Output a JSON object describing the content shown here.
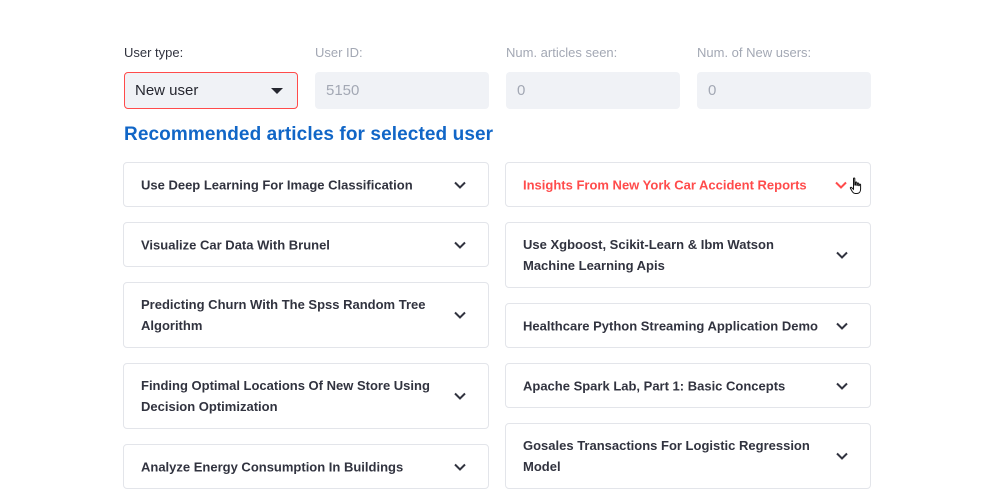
{
  "form": {
    "user_type": {
      "label": "User type:",
      "value": "New user"
    },
    "user_id": {
      "label": "User ID:",
      "value": "5150"
    },
    "num_seen": {
      "label": "Num. articles seen:",
      "value": "0"
    },
    "num_new": {
      "label": "Num. of New users:",
      "value": "0"
    }
  },
  "heading": "Recommended articles for selected user",
  "colors": {
    "accent": "#ff4b4b",
    "heading": "#1166c7"
  },
  "articles_left": [
    "Use Deep Learning For Image Classification",
    "Visualize Car Data With Brunel",
    "Predicting Churn With The Spss Random Tree Algorithm",
    "Finding Optimal Locations Of New Store Using Decision Optimization",
    "Analyze Energy Consumption In Buildings"
  ],
  "articles_right": [
    "Insights From New York Car Accident Reports",
    "Use Xgboost, Scikit-Learn & Ibm Watson Machine Learning Apis",
    "Healthcare Python Streaming Application Demo",
    "Apache Spark Lab, Part 1: Basic Concepts",
    "Gosales Transactions For Logistic Regression Model"
  ]
}
